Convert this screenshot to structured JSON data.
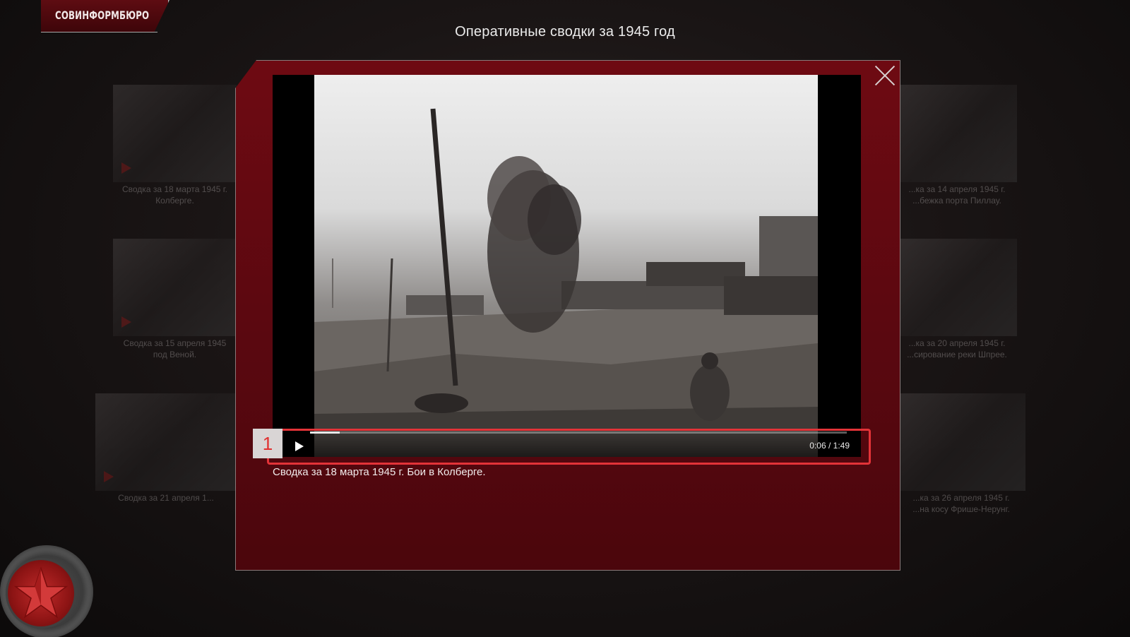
{
  "brand": {
    "label": "СОВИНФОРМБЮРО"
  },
  "page_title": "Оперативные сводки за 1945 год",
  "gallery": {
    "left": [
      {
        "caption": "Сводка за 18 марта 1945 г.\nКолберге."
      },
      {
        "caption": "Сводка за 15 апреля 1945\nпод Веной."
      },
      {
        "caption": "Сводка за 21 апреля 1..."
      }
    ],
    "right": [
      {
        "caption": "...ка за 14 апреля 1945 г.\n...бежка порта Пиллау."
      },
      {
        "caption": "...ка за 20 апреля 1945 г.\n...сирование реки Шпрее."
      },
      {
        "caption": "...ка за 26 апреля 1945 г.\n...на косу Фрише-Нерунг."
      }
    ]
  },
  "modal": {
    "close_icon": "close-icon",
    "video": {
      "time": "0:06 / 1:49",
      "progress_fraction": 0.055,
      "play_icon": "play-icon"
    },
    "caption": "Сводка за 18 марта 1945 г. Бои в Колберге."
  },
  "annotation": {
    "tag": "1",
    "color": "#e33338"
  },
  "nav": {
    "icon": "red-star-icon"
  },
  "colors": {
    "modal": "#5e0810",
    "accent": "#b52525"
  }
}
